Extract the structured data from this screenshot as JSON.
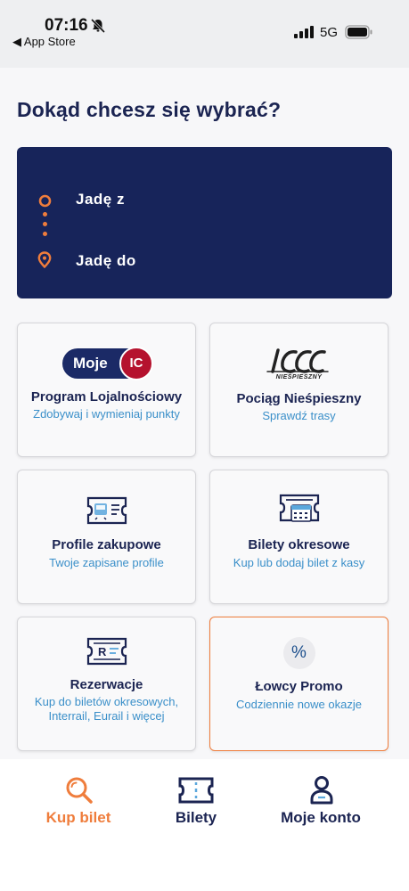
{
  "status_bar": {
    "time": "07:16",
    "back_label": "◀ App Store",
    "network": "5G"
  },
  "page": {
    "title": "Dokąd chcesz się wybrać?"
  },
  "route": {
    "from_label": "Jadę z",
    "to_label": "Jadę do",
    "accent_color": "#ef7d3c",
    "background_color": "#17245a"
  },
  "cards": {
    "loyalty": {
      "logo_left": "Moje",
      "logo_right": "IC",
      "title": "Program Lojalnościowy",
      "subtitle": "Zdobywaj i wymieniaj punkty"
    },
    "slow_train": {
      "logo_text": "ICC",
      "logo_caption": "NIEŚPIESZNY",
      "title": "Pociąg Nieśpieszny",
      "subtitle": "Sprawdź trasy"
    },
    "profiles": {
      "icon": "ticket-train-icon",
      "title": "Profile zakupowe",
      "subtitle": "Twoje zapisane profile"
    },
    "season": {
      "icon": "ticket-calendar-icon",
      "title": "Bilety okresowe",
      "subtitle": "Kup lub dodaj bilet z kasy"
    },
    "reservation": {
      "icon": "ticket-r-icon",
      "icon_letter": "R",
      "title": "Rezerwacje",
      "subtitle": "Kup do biletów okresowych, Interrail, Eurail i więcej"
    },
    "promo": {
      "icon": "percent-icon",
      "icon_symbol": "%",
      "title": "Łowcy Promo",
      "subtitle": "Codziennie nowe okazje",
      "border_color": "#ef7d3c"
    }
  },
  "nav": {
    "items": [
      {
        "label": "Kup bilet",
        "icon": "search-icon",
        "active": true
      },
      {
        "label": "Bilety",
        "icon": "ticket-icon",
        "active": false
      },
      {
        "label": "Moje konto",
        "icon": "user-icon",
        "active": false
      }
    ]
  }
}
